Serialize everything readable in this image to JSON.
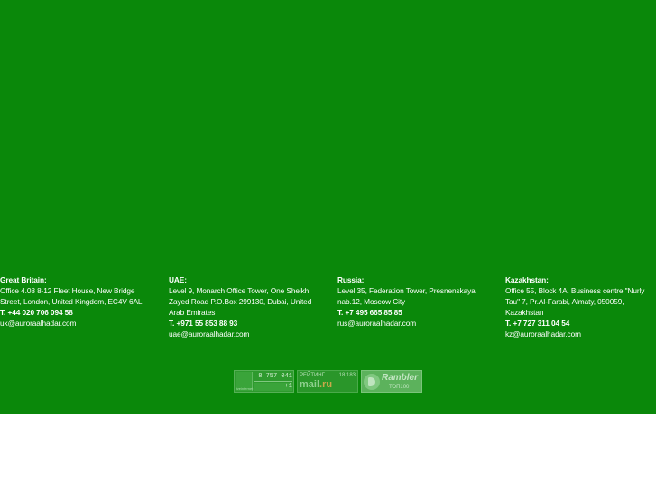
{
  "offices": [
    {
      "title": "Great Britain:",
      "address": "Office 4.08 8-12 Fleet House, New Bridge\nStreet, London, United Kingdom, EC4V 6AL",
      "phone": "T. +44 020 706 094 58",
      "email": "uk@auroraalhadar.com"
    },
    {
      "title": "UAE:",
      "address": "Level 9, Monarch Office Tower, One Sheikh\nZayed Road P.O.Box 299130, Dubai, United\nArab Emirates",
      "phone": "T. +971 55 853 88 93",
      "email": "uae@auroraalhadar.com"
    },
    {
      "title": "Russia:",
      "address": "Level 35, Federation Tower, Presnenskaya\nnab.12, Moscow City",
      "phone": "T. +7 495 665 85 85",
      "email": "rus@auroraalhadar.com"
    },
    {
      "title": "Kazakhstan:",
      "address": "Office 55, Block 4A, Business centre \"Nurly\nTau\" 7, Pr.Al-Farabi, Almaty, 050059,\nKazakhstan",
      "phone": "T. +7 727 311 04 54",
      "email": "kz@auroraalhadar.com"
    }
  ],
  "counters": {
    "liveinternet": {
      "total": "8 757 041",
      "today": "+1",
      "logo_text": "liveinternet"
    },
    "mailru": {
      "rating_label": "РЕЙТИНГ",
      "rating_value": "18 183",
      "logo": "mail",
      "logo_suffix": ".ru"
    },
    "rambler": {
      "title": "Rambler",
      "subtitle": "ТОП100"
    }
  },
  "colors": {
    "footer_bg": "#0a880a",
    "page_bg": "#ffffff",
    "text": "#ffffff"
  }
}
